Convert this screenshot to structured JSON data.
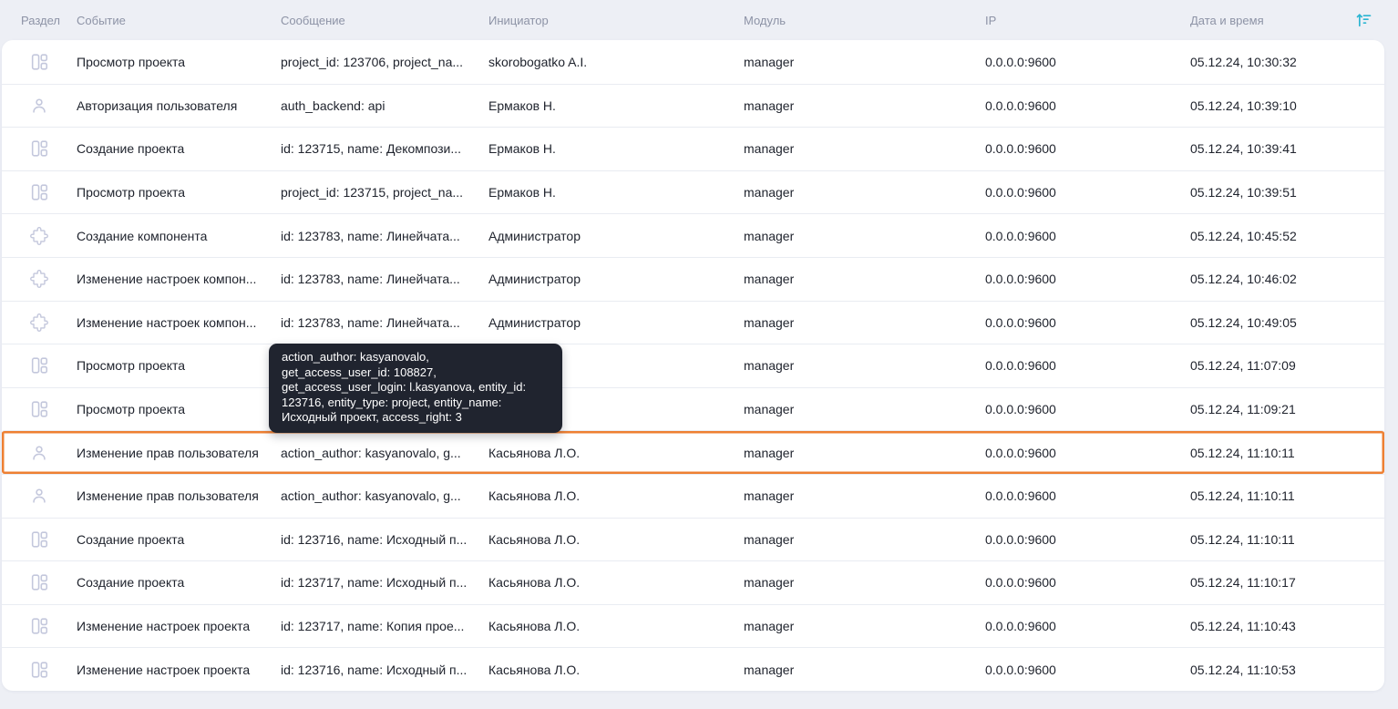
{
  "colors": {
    "highlight_border": "#ee8033",
    "sort_icon": "#2bb5d2",
    "tooltip_bg": "#20242f",
    "page_background": "#edeff5",
    "row_background": "#ffffff",
    "header_text": "#8d93a6",
    "row_text": "#20242e",
    "section_icon": "#c3c7dc"
  },
  "header": {
    "columns": [
      "Раздел",
      "Событие",
      "Сообщение",
      "Инициатор",
      "Модуль",
      "IP",
      "Дата и время"
    ],
    "sort_icon": "sort-ascending-icon"
  },
  "tooltip": {
    "text": "action_author: kasyanovalo,\nget_access_user_id: 108827,\nget_access_user_login: l.kasyanova, entity_id:\n123716, entity_type: project, entity_name:\nИсходный проект, access_right: 3"
  },
  "rows": [
    {
      "section_icon": "project-icon",
      "event": "Просмотр проекта",
      "message": "project_id: 123706, project_na...",
      "initiator": "skorobogatko A.I.",
      "module": "manager",
      "ip": "0.0.0.0:9600",
      "datetime": "05.12.24, 10:30:32",
      "highlighted": false
    },
    {
      "section_icon": "user-icon",
      "event": "Авторизация пользователя",
      "message": "auth_backend: api",
      "initiator": "Ермаков Н.",
      "module": "manager",
      "ip": "0.0.0.0:9600",
      "datetime": "05.12.24, 10:39:10",
      "highlighted": false
    },
    {
      "section_icon": "project-icon",
      "event": "Создание проекта",
      "message": "id: 123715, name: Декомпози...",
      "initiator": "Ермаков Н.",
      "module": "manager",
      "ip": "0.0.0.0:9600",
      "datetime": "05.12.24, 10:39:41",
      "highlighted": false
    },
    {
      "section_icon": "project-icon",
      "event": "Просмотр проекта",
      "message": "project_id: 123715, project_na...",
      "initiator": "Ермаков Н.",
      "module": "manager",
      "ip": "0.0.0.0:9600",
      "datetime": "05.12.24, 10:39:51",
      "highlighted": false
    },
    {
      "section_icon": "component-icon",
      "event": "Создание компонента",
      "message": "id: 123783, name: Линейчата...",
      "initiator": "Администратор",
      "module": "manager",
      "ip": "0.0.0.0:9600",
      "datetime": "05.12.24, 10:45:52",
      "highlighted": false
    },
    {
      "section_icon": "component-icon",
      "event": "Изменение настроек компон...",
      "message": "id: 123783, name: Линейчата...",
      "initiator": "Администратор",
      "module": "manager",
      "ip": "0.0.0.0:9600",
      "datetime": "05.12.24, 10:46:02",
      "highlighted": false
    },
    {
      "section_icon": "component-icon",
      "event": "Изменение настроек компон...",
      "message": "id: 123783, name: Линейчата...",
      "initiator": "Администратор",
      "module": "manager",
      "ip": "0.0.0.0:9600",
      "datetime": "05.12.24, 10:49:05",
      "highlighted": false
    },
    {
      "section_icon": "project-icon",
      "event": "Просмотр проекта",
      "message": "",
      "initiator": "",
      "module": "manager",
      "ip": "0.0.0.0:9600",
      "datetime": "05.12.24, 11:07:09",
      "highlighted": false
    },
    {
      "section_icon": "project-icon",
      "event": "Просмотр проекта",
      "message": "",
      "initiator": "",
      "module": "manager",
      "ip": "0.0.0.0:9600",
      "datetime": "05.12.24, 11:09:21",
      "highlighted": false
    },
    {
      "section_icon": "user-icon",
      "event": "Изменение прав пользователя",
      "message": "action_author: kasyanovalo, g...",
      "initiator": "Касьянова Л.О.",
      "module": "manager",
      "ip": "0.0.0.0:9600",
      "datetime": "05.12.24, 11:10:11",
      "highlighted": true
    },
    {
      "section_icon": "user-icon",
      "event": "Изменение прав пользователя",
      "message": "action_author: kasyanovalo, g...",
      "initiator": "Касьянова Л.О.",
      "module": "manager",
      "ip": "0.0.0.0:9600",
      "datetime": "05.12.24, 11:10:11",
      "highlighted": false
    },
    {
      "section_icon": "project-icon",
      "event": "Создание проекта",
      "message": "id: 123716, name: Исходный п...",
      "initiator": "Касьянова Л.О.",
      "module": "manager",
      "ip": "0.0.0.0:9600",
      "datetime": "05.12.24, 11:10:11",
      "highlighted": false
    },
    {
      "section_icon": "project-icon",
      "event": "Создание проекта",
      "message": "id: 123717, name: Исходный п...",
      "initiator": "Касьянова Л.О.",
      "module": "manager",
      "ip": "0.0.0.0:9600",
      "datetime": "05.12.24, 11:10:17",
      "highlighted": false
    },
    {
      "section_icon": "project-icon",
      "event": "Изменение настроек проекта",
      "message": "id: 123717, name: Копия прое...",
      "initiator": "Касьянова Л.О.",
      "module": "manager",
      "ip": "0.0.0.0:9600",
      "datetime": "05.12.24, 11:10:43",
      "highlighted": false
    },
    {
      "section_icon": "project-icon",
      "event": "Изменение настроек проекта",
      "message": "id: 123716, name: Исходный п...",
      "initiator": "Касьянова Л.О.",
      "module": "manager",
      "ip": "0.0.0.0:9600",
      "datetime": "05.12.24, 11:10:53",
      "highlighted": false
    }
  ]
}
